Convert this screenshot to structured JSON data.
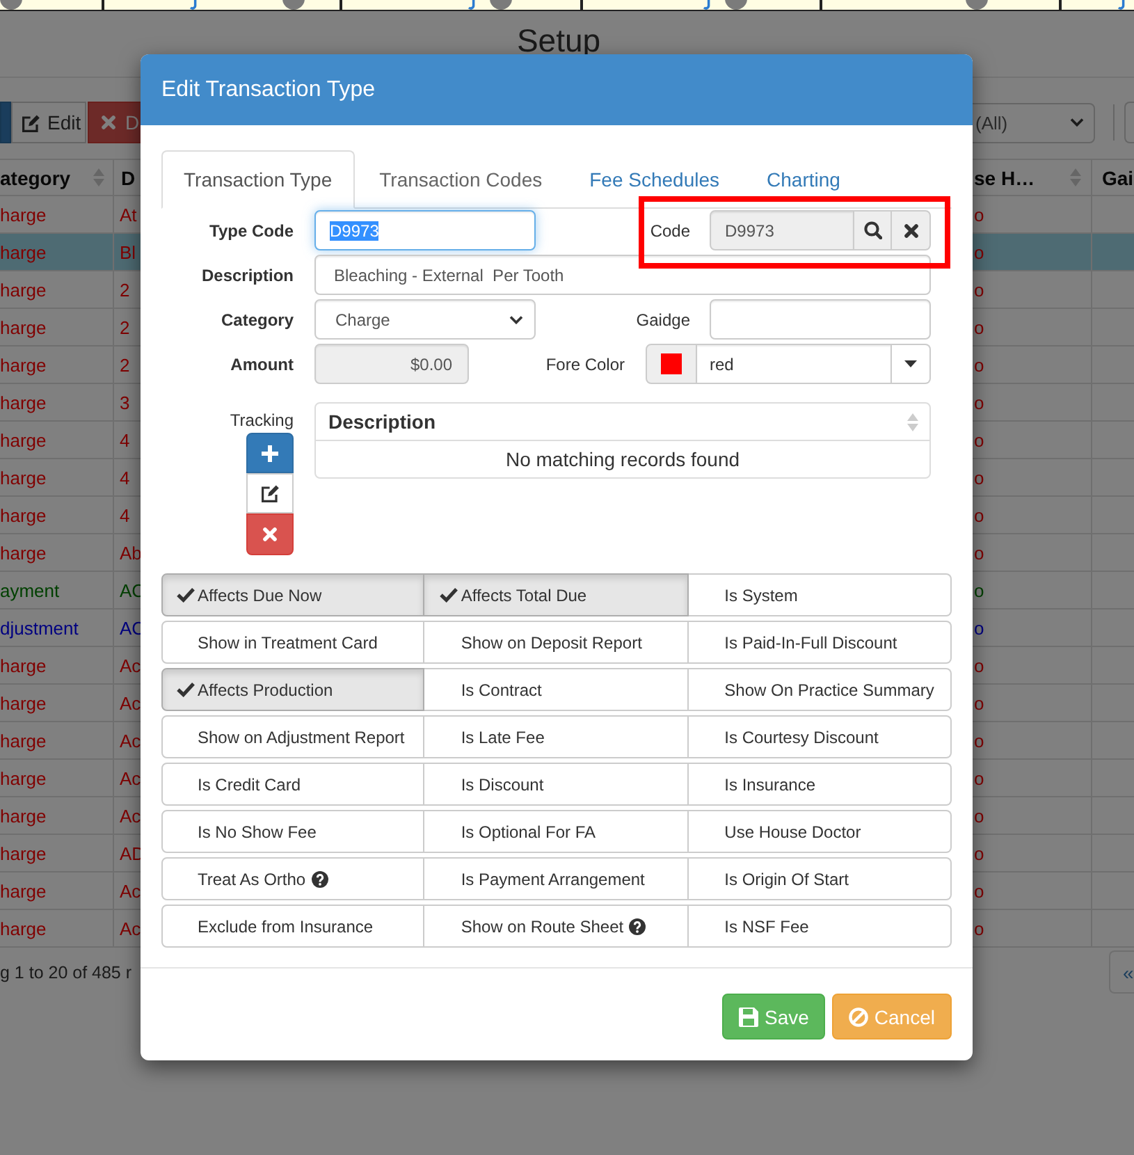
{
  "page": {
    "title": "Setup",
    "toolbar": [
      {
        "kind": "primary"
      },
      {
        "kind": "default",
        "label": "Edit"
      },
      {
        "kind": "danger",
        "label": "D"
      }
    ],
    "filter": {
      "value": "(All)"
    },
    "table": {
      "columns": [
        {
          "label": "ategory",
          "sortable": true
        },
        {
          "label": "D"
        },
        {
          "label": "se H…",
          "sortable": true
        },
        {
          "label": "Gai"
        }
      ],
      "rows": [
        {
          "cells": [
            "harge",
            "At",
            "o"
          ],
          "color": "#800000",
          "selected": false
        },
        {
          "cells": [
            "harge",
            "Bl",
            "o"
          ],
          "color": "#800000",
          "selected": true
        },
        {
          "cells": [
            "harge",
            "2",
            "o"
          ],
          "color": "#800000",
          "selected": false
        },
        {
          "cells": [
            "harge",
            "2",
            "o"
          ],
          "color": "#800000",
          "selected": false
        },
        {
          "cells": [
            "harge",
            "2",
            "o"
          ],
          "color": "#800000",
          "selected": false
        },
        {
          "cells": [
            "harge",
            "3",
            "o"
          ],
          "color": "#800000",
          "selected": false
        },
        {
          "cells": [
            "harge",
            "4",
            "o"
          ],
          "color": "#800000",
          "selected": false
        },
        {
          "cells": [
            "harge",
            "4",
            "o"
          ],
          "color": "#800000",
          "selected": false
        },
        {
          "cells": [
            "harge",
            "4",
            "o"
          ],
          "color": "#800000",
          "selected": false
        },
        {
          "cells": [
            "harge",
            "Ab",
            "o"
          ],
          "color": "#800000",
          "selected": false
        },
        {
          "cells": [
            "ayment",
            "AC",
            "o"
          ],
          "color": "#004000",
          "selected": false
        },
        {
          "cells": [
            "djustment",
            "AC",
            "o"
          ],
          "color": "#000080",
          "selected": false
        },
        {
          "cells": [
            "harge",
            "Ac",
            "o"
          ],
          "color": "#800000",
          "selected": false
        },
        {
          "cells": [
            "harge",
            "Ac",
            "o"
          ],
          "color": "#800000",
          "selected": false
        },
        {
          "cells": [
            "harge",
            "Ac",
            "o"
          ],
          "color": "#800000",
          "selected": false
        },
        {
          "cells": [
            "harge",
            "Ac",
            "o"
          ],
          "color": "#800000",
          "selected": false
        },
        {
          "cells": [
            "harge",
            "Ac",
            "o"
          ],
          "color": "#800000",
          "selected": false
        },
        {
          "cells": [
            "harge",
            "AD",
            "o"
          ],
          "color": "#800000",
          "selected": false
        },
        {
          "cells": [
            "harge",
            "Ac",
            "o"
          ],
          "color": "#800000",
          "selected": false
        },
        {
          "cells": [
            "harge",
            "Ac",
            "o"
          ],
          "color": "#800000",
          "selected": false
        }
      ]
    },
    "footer": {
      "summary": "g 1 to 20 of 485 r",
      "pager": "«"
    }
  },
  "modal": {
    "title": "Edit Transaction Type",
    "tabs": [
      {
        "label": "Transaction Type",
        "selected": true,
        "disabled": false
      },
      {
        "label": "Transaction Codes",
        "selected": false,
        "disabled": true
      },
      {
        "label": "Fee Schedules",
        "selected": false,
        "disabled": false
      },
      {
        "label": "Charting",
        "selected": false,
        "disabled": false
      }
    ],
    "form": {
      "type_code": {
        "label": "Type Code",
        "value": "D9973",
        "focused": true,
        "text_selected": true
      },
      "code": {
        "label": "Code",
        "value": "D9973",
        "highlighted": true
      },
      "description": {
        "label": "Description",
        "value": "Bleaching - External  Per Tooth"
      },
      "category": {
        "label": "Category",
        "value": "Charge"
      },
      "gaidge": {
        "label": "Gaidge"
      },
      "amount": {
        "label": "Amount",
        "value": "$0.00"
      },
      "fore_color": {
        "label": "Fore Color",
        "value": "red",
        "color": "#ff0000"
      }
    },
    "tracking": {
      "label": "Tracking",
      "buttons": [
        {
          "kind": "add"
        },
        {
          "kind": "edit"
        },
        {
          "kind": "delete"
        }
      ],
      "table": {
        "columns": [
          {
            "label": "Description",
            "sortable": true
          }
        ],
        "empty_text": "No matching records found"
      }
    },
    "options": [
      {
        "label": "Affects Due Now",
        "checked": true,
        "help": false
      },
      {
        "label": "Affects Total Due",
        "checked": true,
        "help": false
      },
      {
        "label": "Is System",
        "checked": false,
        "help": false
      },
      {
        "label": "Show in Treatment Card",
        "checked": false,
        "help": false
      },
      {
        "label": "Show on Deposit Report",
        "checked": false,
        "help": false
      },
      {
        "label": "Is Paid-In-Full Discount",
        "checked": false,
        "help": false
      },
      {
        "label": "Affects Production",
        "checked": true,
        "help": false
      },
      {
        "label": "Is Contract",
        "checked": false,
        "help": false
      },
      {
        "label": "Show On Practice Summary",
        "checked": false,
        "help": false
      },
      {
        "label": "Show on Adjustment Report",
        "checked": false,
        "help": false
      },
      {
        "label": "Is Late Fee",
        "checked": false,
        "help": false
      },
      {
        "label": "Is Courtesy Discount",
        "checked": false,
        "help": false
      },
      {
        "label": "Is Credit Card",
        "checked": false,
        "help": false
      },
      {
        "label": "Is Discount",
        "checked": false,
        "help": false
      },
      {
        "label": "Is Insurance",
        "checked": false,
        "help": false
      },
      {
        "label": "Is No Show Fee",
        "checked": false,
        "help": false
      },
      {
        "label": "Is Optional For FA",
        "checked": false,
        "help": false
      },
      {
        "label": "Use House Doctor",
        "checked": false,
        "help": false
      },
      {
        "label": "Treat As Ortho",
        "checked": false,
        "help": true
      },
      {
        "label": "Is Payment Arrangement",
        "checked": false,
        "help": false
      },
      {
        "label": "Is Origin Of Start",
        "checked": false,
        "help": false
      },
      {
        "label": "Exclude from Insurance",
        "checked": false,
        "help": false
      },
      {
        "label": "Show on Route Sheet",
        "checked": false,
        "help": true
      },
      {
        "label": "Is NSF Fee",
        "checked": false,
        "help": false
      }
    ],
    "buttons": [
      {
        "kind": "save",
        "label": "Save"
      },
      {
        "kind": "cancel",
        "label": "Cancel"
      }
    ]
  }
}
